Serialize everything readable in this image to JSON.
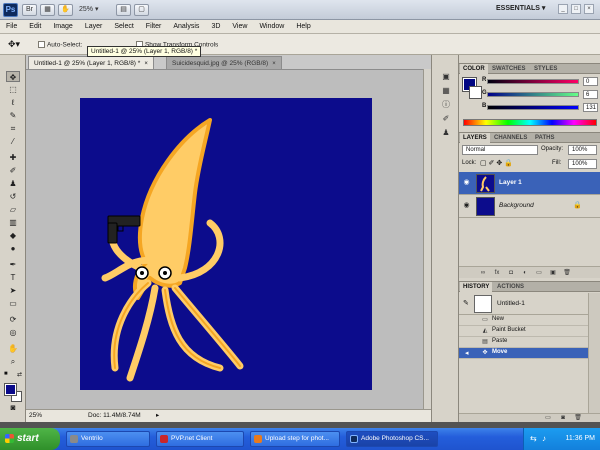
{
  "app": {
    "logo": "Ps",
    "zoom_select": "25%",
    "workspace": "ESSENTIALS"
  },
  "menus": [
    "File",
    "Edit",
    "Image",
    "Layer",
    "Select",
    "Filter",
    "Analysis",
    "3D",
    "View",
    "Window",
    "Help"
  ],
  "options": {
    "auto_select": "Auto-Select:",
    "transform_controls": "Show Transform Controls"
  },
  "tooltip": "Untitled-1 @ 25% (Layer 1, RGB/8) *",
  "tabs": [
    {
      "label": "Untitled-1 @ 25% (Layer 1, RGB/8) *",
      "active": true
    },
    {
      "label": "Suicidesquid.jpg @ 25% (RGB/8)",
      "active": false
    }
  ],
  "status": {
    "zoom": "25%",
    "doc": "Doc: 11.4M/8.74M"
  },
  "color_panel": {
    "tabs": [
      "COLOR",
      "SWATCHES",
      "STYLES"
    ],
    "channels": [
      {
        "label": "R",
        "value": "0"
      },
      {
        "label": "G",
        "value": "6"
      },
      {
        "label": "B",
        "value": "131"
      }
    ],
    "foreground": "#000683"
  },
  "layers_panel": {
    "tabs": [
      "LAYERS",
      "CHANNELS",
      "PATHS"
    ],
    "blend_mode": "Normal",
    "opacity_label": "Opacity:",
    "opacity": "100%",
    "lock_label": "Lock:",
    "fill_label": "Fill:",
    "fill": "100%",
    "layers": [
      {
        "name": "Layer 1",
        "selected": true
      },
      {
        "name": "Background",
        "selected": false
      }
    ]
  },
  "history_panel": {
    "tabs": [
      "HISTORY",
      "ACTIONS"
    ],
    "snapshot": "Untitled-1",
    "steps": [
      "New",
      "Paint Bucket",
      "Paste",
      "Move"
    ],
    "active_step": "Move"
  },
  "taskbar": {
    "start": "start",
    "tasks": [
      {
        "label": "Ventrilo",
        "color": "#8a8a8a"
      },
      {
        "label": "PVP.net Client",
        "color": "#c8262b"
      },
      {
        "label": "Upload step for phot...",
        "color": "#e87a1e"
      },
      {
        "label": "Adobe Photoshop CS...",
        "color": "#0e2a5c",
        "active": true
      }
    ],
    "clock": "11:36 PM"
  }
}
